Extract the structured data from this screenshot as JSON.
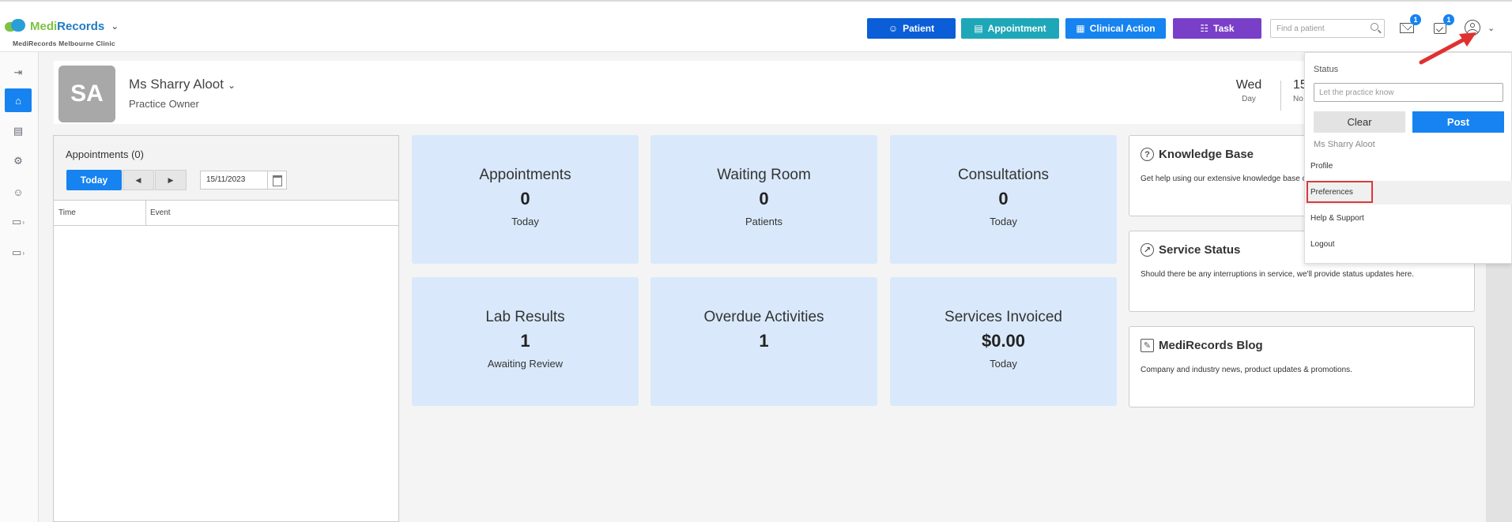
{
  "header": {
    "logo_medi": "Medi",
    "logo_records": "Records",
    "clinic": "MediRecords Melbourne Clinic",
    "buttons": {
      "patient": "Patient",
      "appointment": "Appointment",
      "clinical_action": "Clinical Action",
      "task": "Task"
    },
    "search_placeholder": "Find a patient",
    "mail_count": "1",
    "tasks_count": "1"
  },
  "sidebar": {
    "items": [
      "expand-icon",
      "home-icon",
      "calendar-icon",
      "activities-icon",
      "patients-icon",
      "folder-icon",
      "export-folder-icon"
    ]
  },
  "profile": {
    "initials": "SA",
    "name": "Ms Sharry Aloot",
    "role": "Practice Owner",
    "day_name": "Wed",
    "day_label": "Day",
    "date_partial": "15",
    "date_partial_label": "No"
  },
  "appointments": {
    "title": "Appointments (0)",
    "today_label": "Today",
    "date": "15/11/2023",
    "col_time": "Time",
    "col_event": "Event"
  },
  "tiles": [
    {
      "title": "Appointments",
      "value": "0",
      "sub": "Today"
    },
    {
      "title": "Waiting Room",
      "value": "0",
      "sub": "Patients"
    },
    {
      "title": "Consultations",
      "value": "0",
      "sub": "Today"
    },
    {
      "title": "Lab Results",
      "value": "1",
      "sub": "Awaiting Review"
    },
    {
      "title": "Overdue Activities",
      "value": "1",
      "sub": ""
    },
    {
      "title": "Services Invoiced",
      "value": "$0.00",
      "sub": "Today"
    }
  ],
  "cards": [
    {
      "title": "Knowledge Base",
      "body": "Get help using our extensive knowledge base c"
    },
    {
      "title": "Service Status",
      "body": "Should there be any interruptions in service, we'll provide status updates here."
    },
    {
      "title": "MediRecords Blog",
      "body": "Company and industry news, product updates & promotions."
    }
  ],
  "dropdown": {
    "status_label": "Status",
    "status_placeholder": "Let the practice know",
    "clear": "Clear",
    "post": "Post",
    "user_name": "Ms Sharry Aloot",
    "items": [
      "Profile",
      "Preferences",
      "Help & Support",
      "Logout"
    ]
  },
  "colors": {
    "primary": "#1683f0",
    "patient_btn": "#0b5ed7",
    "appointment_btn": "#1ea7b8",
    "task_btn": "#7a3fc9",
    "tile_bg": "#d9e9fb",
    "highlight_box": "#d93a3a"
  }
}
